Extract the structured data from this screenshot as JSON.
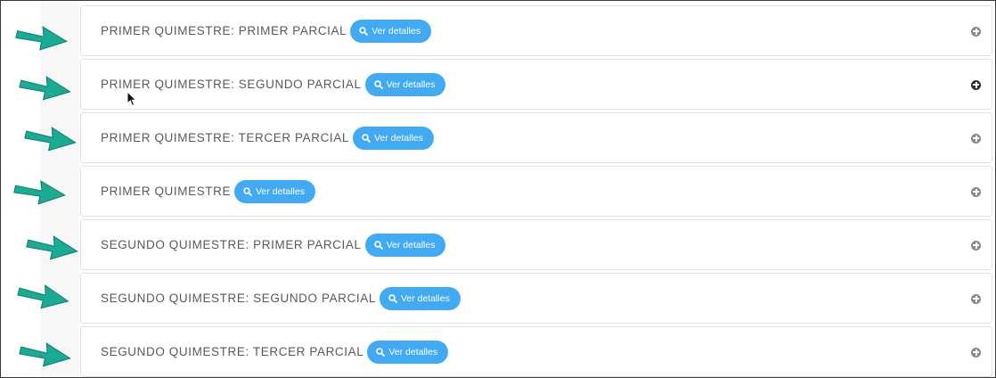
{
  "colors": {
    "arrow": "#1aab95",
    "button": "#42aaf2",
    "title_text": "#555a60",
    "expand_icon": "#8a8a8a",
    "expand_icon_hover": "#2e2e2e"
  },
  "panels": [
    {
      "title": "PRIMER QUIMESTRE: PRIMER PARCIAL",
      "button_label": "Ver detalles",
      "button_icon": "search-icon",
      "expand_icon": "plus-circle-icon"
    },
    {
      "title": "PRIMER QUIMESTRE: SEGUNDO PARCIAL",
      "button_label": "Ver detalles",
      "button_icon": "search-icon",
      "expand_icon": "plus-circle-icon",
      "hovered": true
    },
    {
      "title": "PRIMER QUIMESTRE: TERCER PARCIAL",
      "button_label": "Ver detalles",
      "button_icon": "search-icon",
      "expand_icon": "plus-circle-icon"
    },
    {
      "title": "PRIMER QUIMESTRE",
      "button_label": "Ver detalles",
      "button_icon": "search-icon",
      "expand_icon": "plus-circle-icon"
    },
    {
      "title": "SEGUNDO QUIMESTRE: PRIMER PARCIAL",
      "button_label": "Ver detalles",
      "button_icon": "search-icon",
      "expand_icon": "plus-circle-icon"
    },
    {
      "title": "SEGUNDO QUIMESTRE: SEGUNDO PARCIAL",
      "button_label": "Ver detalles",
      "button_icon": "search-icon",
      "expand_icon": "plus-circle-icon"
    },
    {
      "title": "SEGUNDO QUIMESTRE: TERCER PARCIAL",
      "button_label": "Ver detalles",
      "button_icon": "search-icon",
      "expand_icon": "plus-circle-icon"
    }
  ],
  "annotations": {
    "arrow_icon": "arrow-right-icon",
    "arrow_count": 7
  },
  "cursor_icon": "mouse-pointer-icon"
}
